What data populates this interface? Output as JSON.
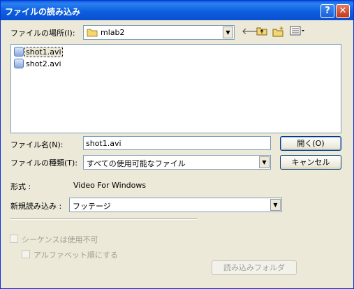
{
  "window": {
    "title": "ファイルの読み込み",
    "help_glyph": "?",
    "close_glyph": "✕"
  },
  "look_in": {
    "label": "ファイルの場所(I):",
    "value": "mlab2"
  },
  "files": [
    {
      "name": "shot1.avi",
      "selected": true
    },
    {
      "name": "shot2.avi",
      "selected": false
    }
  ],
  "filename": {
    "label": "ファイル名(N):",
    "value": "shot1.avi"
  },
  "filetype": {
    "label": "ファイルの種類(T):",
    "value": "すべての使用可能なファイル"
  },
  "buttons": {
    "open": "開く(O)",
    "cancel": "キャンセル",
    "import_folder": "読み込みフォルダ"
  },
  "format": {
    "label": "形式 :",
    "value": "Video For Windows"
  },
  "import_as": {
    "label": "新規読み込み :",
    "value": "フッテージ"
  },
  "options": {
    "sequence_label": "シーケンスは使用不可",
    "alphabetical_label": "アルファベット順にする"
  },
  "icons": {
    "folder": "folder-icon",
    "back": "back-arrow-icon",
    "up": "up-folder-icon",
    "new_folder": "new-folder-icon",
    "view": "view-menu-icon",
    "file": "avi-file-icon"
  }
}
